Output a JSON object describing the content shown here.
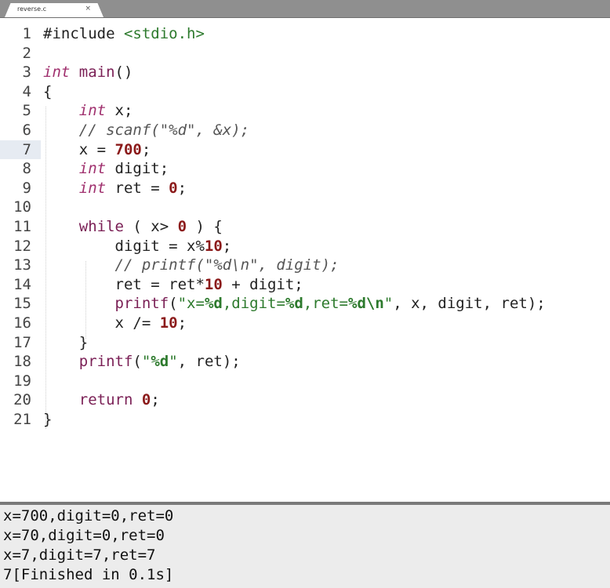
{
  "tab": {
    "title": "reverse.c",
    "close": "×"
  },
  "editor": {
    "lines": [
      {
        "n": "1",
        "t": "#include <stdio.h>"
      },
      {
        "n": "2",
        "t": ""
      },
      {
        "n": "3",
        "t": "int main()"
      },
      {
        "n": "4",
        "t": "{"
      },
      {
        "n": "5",
        "t": "    int x;"
      },
      {
        "n": "6",
        "t": "    // scanf(\"%d\", &x);"
      },
      {
        "n": "7",
        "t": "    x = 700;"
      },
      {
        "n": "8",
        "t": "    int digit;"
      },
      {
        "n": "9",
        "t": "    int ret = 0;"
      },
      {
        "n": "10",
        "t": ""
      },
      {
        "n": "11",
        "t": "    while ( x> 0 ) {"
      },
      {
        "n": "12",
        "t": "        digit = x%10;"
      },
      {
        "n": "13",
        "t": "        // printf(\"%d\\n\", digit);"
      },
      {
        "n": "14",
        "t": "        ret = ret*10 + digit;"
      },
      {
        "n": "15",
        "t": "        printf(\"x=%d,digit=%d,ret=%d\\n\", x, digit, ret);"
      },
      {
        "n": "16",
        "t": "        x /= 10;"
      },
      {
        "n": "17",
        "t": "    }"
      },
      {
        "n": "18",
        "t": "    printf(\"%d\", ret);"
      },
      {
        "n": "19",
        "t": ""
      },
      {
        "n": "20",
        "t": "    return 0;"
      },
      {
        "n": "21",
        "t": "}"
      }
    ],
    "active_line": "7"
  },
  "console": {
    "lines": [
      "x=700,digit=0,ret=0",
      "x=70,digit=0,ret=0",
      "x=7,digit=7,ret=7",
      "7[Finished in 0.1s]"
    ]
  }
}
